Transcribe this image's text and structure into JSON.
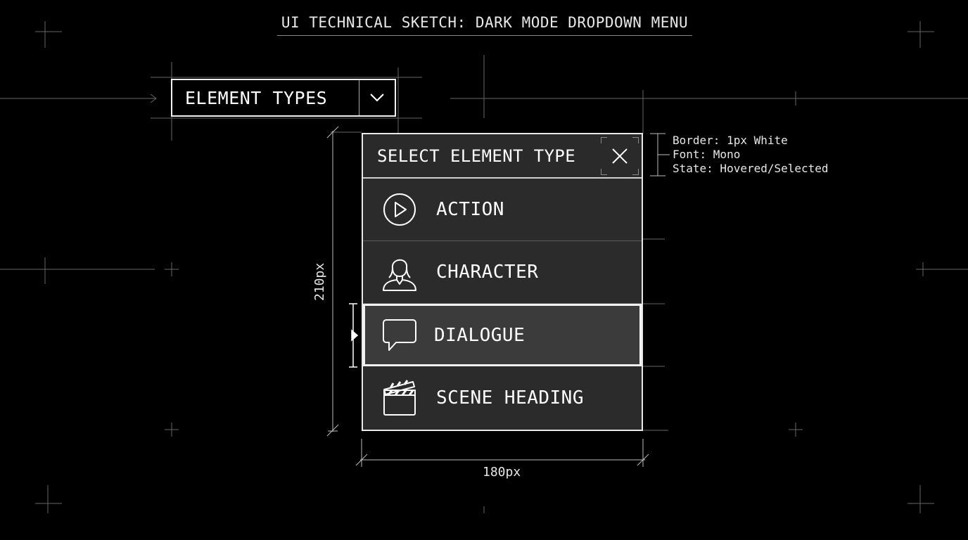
{
  "title": "UI TECHNICAL SKETCH: DARK MODE DROPDOWN MENU",
  "trigger": {
    "label": "ELEMENT TYPES",
    "icon": "chevron-down-icon"
  },
  "panel": {
    "title": "SELECT ELEMENT TYPE",
    "close_icon": "close-icon",
    "items": [
      {
        "label": "ACTION",
        "icon": "play-circle-icon",
        "selected": false
      },
      {
        "label": "CHARACTER",
        "icon": "person-icon",
        "selected": false
      },
      {
        "label": "DIALOGUE",
        "icon": "speech-bubble-icon",
        "selected": true
      },
      {
        "label": "SCENE HEADING",
        "icon": "clapperboard-icon",
        "selected": false
      }
    ]
  },
  "notes": [
    "Border: 1px White",
    "Font: Mono",
    "State: Hovered/Selected"
  ],
  "dimensions": {
    "width_label": "180px",
    "height_label": "210px"
  },
  "colors": {
    "background": "#000000",
    "panel": "#2b2b2b",
    "selected": "#3b3b3b",
    "line": "#ffffff"
  }
}
